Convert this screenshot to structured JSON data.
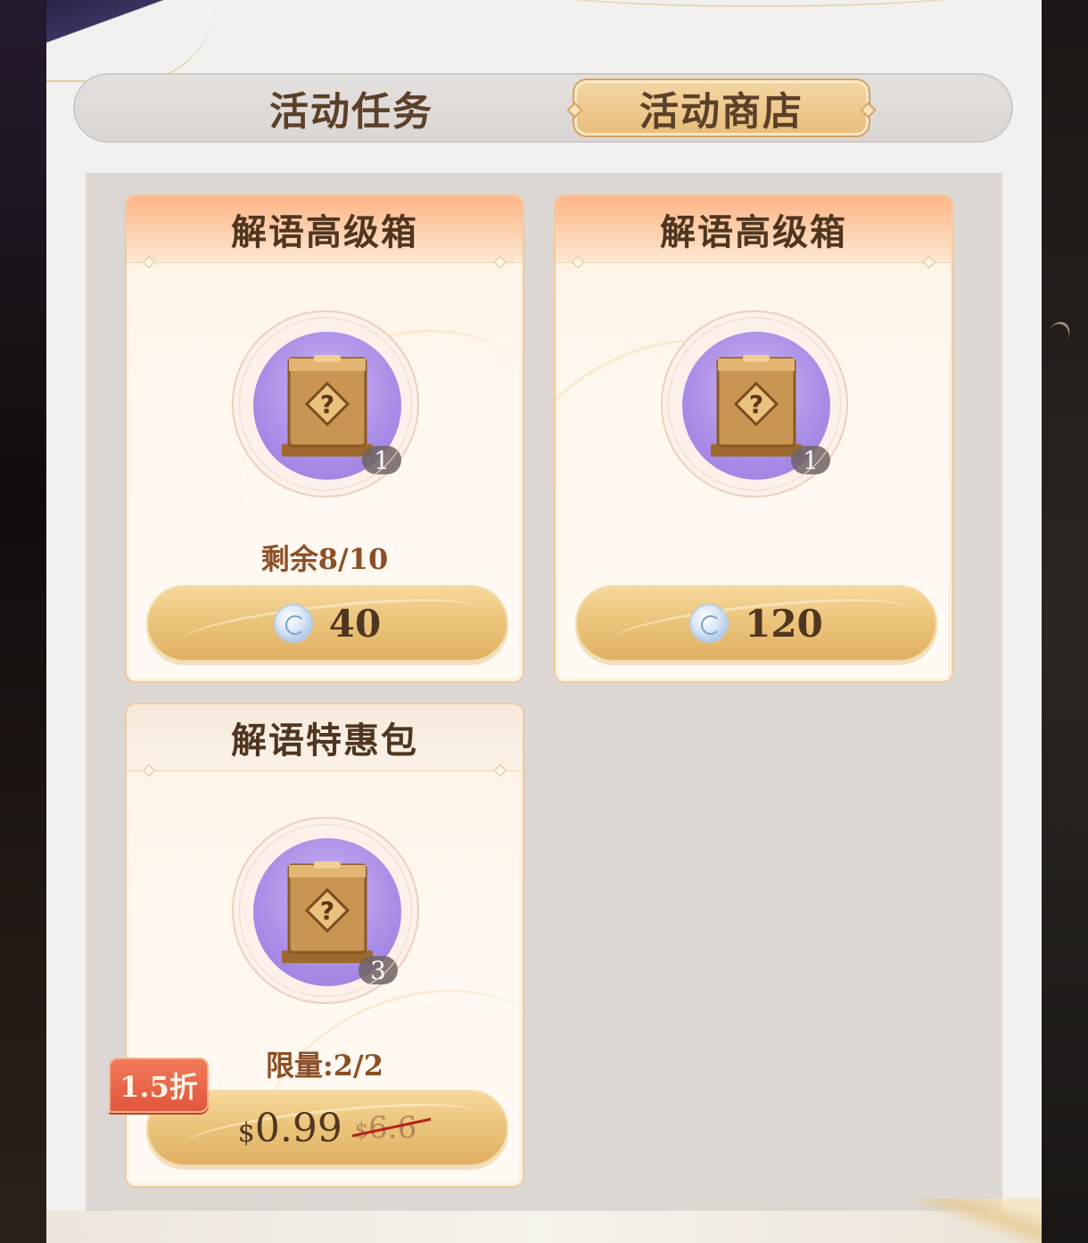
{
  "tabs": [
    {
      "label": "活动任务",
      "active": false
    },
    {
      "label": "活动商店",
      "active": true
    }
  ],
  "items": [
    {
      "title": "解语高级箱",
      "icon": "mystery-box-icon",
      "quantity": "1",
      "remaining": "剩余8/10",
      "currency_icon": "silver-coin-icon",
      "price": "40"
    },
    {
      "title": "解语高级箱",
      "icon": "mystery-box-icon",
      "quantity": "1",
      "remaining": "",
      "currency_icon": "silver-coin-icon",
      "price": "120"
    },
    {
      "title": "解语特惠包",
      "icon": "mystery-box-icon",
      "quantity": "3",
      "remaining": "限量:2/2",
      "discount": "1.5折",
      "currency_symbol": "$",
      "price": "0.99",
      "original_price": "6.6"
    }
  ],
  "colors": {
    "accent_gold": "#e8bd7b",
    "header_orange": "#ffb588",
    "discount_red": "#e0553b",
    "box_purple": "#a98ce6"
  }
}
